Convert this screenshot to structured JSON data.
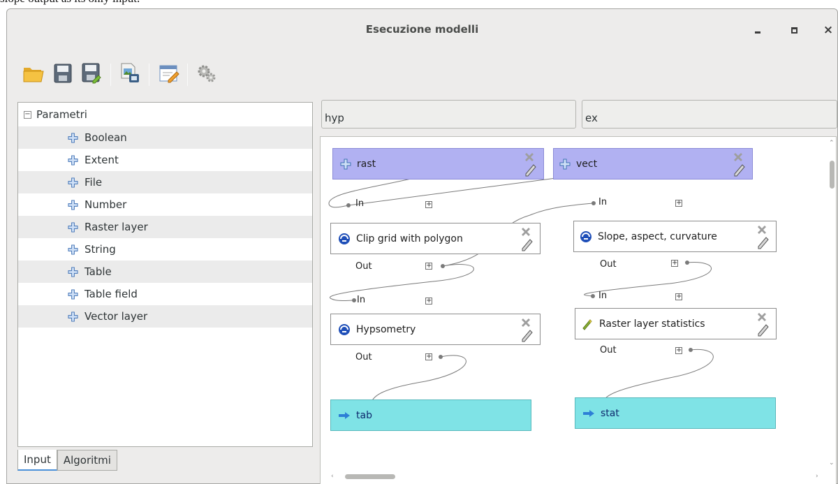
{
  "caption": "slope output as its only input.",
  "window": {
    "title": "Esecuzione modelli",
    "min_icon": "minimize-icon",
    "max_icon": "maximize-icon",
    "close_icon": "close-icon",
    "close_glyph": "×"
  },
  "toolbar": {
    "buttons": [
      "open-model",
      "save-model",
      "save-model-as",
      "export-image",
      "edit-help",
      "run-model"
    ]
  },
  "params": {
    "root": "Parametri",
    "items": [
      "Boolean",
      "Extent",
      "File",
      "Number",
      "Raster layer",
      "String",
      "Table",
      "Table field",
      "Vector layer"
    ]
  },
  "tabs": {
    "input": "Input",
    "algorithms": "Algoritmi"
  },
  "model": {
    "name": "hyp",
    "group": "ex"
  },
  "graph": {
    "inputs": {
      "rast": "rast",
      "vect": "vect"
    },
    "algorithms": {
      "clip": "Clip grid with polygon",
      "slope": "Slope, aspect, curvature",
      "hyps": "Hypsometry",
      "stats": "Raster layer statistics"
    },
    "outputs": {
      "tab": "tab",
      "stat": "stat"
    },
    "port_in": "In",
    "port_out": "Out",
    "expand_glyph": "+"
  },
  "colors": {
    "input_node": "#b1b1f2",
    "output_node": "#7fe3e6",
    "algorithm_node": "#ffffff"
  }
}
